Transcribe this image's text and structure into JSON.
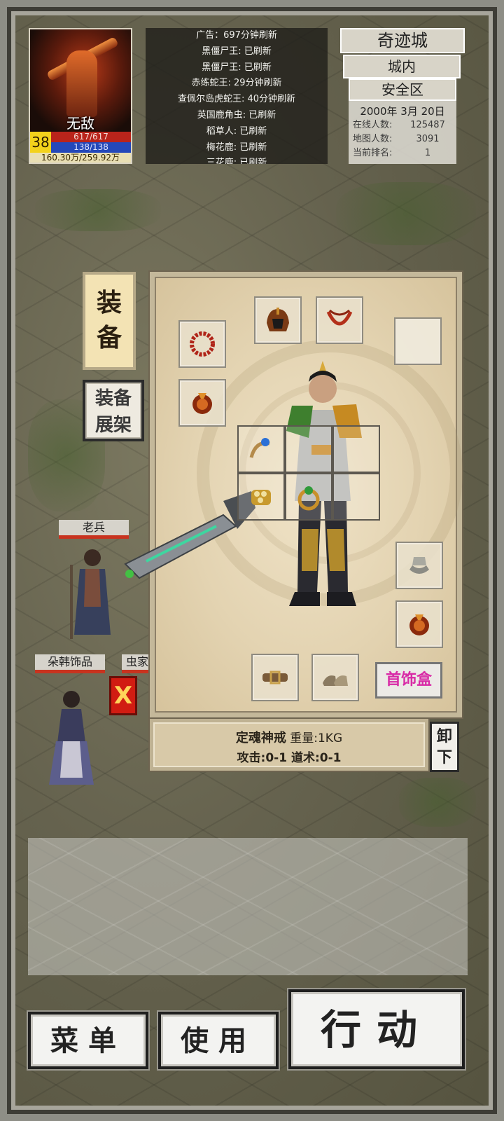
{
  "player": {
    "name": "无敌",
    "level": "38",
    "hp": "617/617",
    "mp": "138/138",
    "exp": "160.30万/259.92万"
  },
  "notices": [
    "广告：697分钟刷新",
    "黑僵尸王: 已刷新",
    "黑僵尸王: 已刷新",
    "赤练蛇王: 29分钟刷新",
    "查佩尔岛虎蛇王: 40分钟刷新",
    "英国鹿角虫: 已刷新",
    "稻草人: 已刷新",
    "梅花鹿: 已刷新",
    "三花鹿: 已刷新"
  ],
  "location": {
    "city": "奇迹城",
    "area": "城内",
    "zone": "安全区",
    "date": "2000年 3月 20日",
    "online_label": "在线人数:",
    "online_value": "125487",
    "map_label": "地图人数:",
    "map_value": "3091",
    "rank_label": "当前排名:",
    "rank_value": "1"
  },
  "tabs": {
    "equip_line1": "装",
    "equip_line2": "备",
    "shelf_line1": "装备",
    "shelf_line2": "展架"
  },
  "npcs": {
    "veteran": "老兵",
    "jewelry": "朵韩饰品",
    "cut": "虫家"
  },
  "close_label": "X",
  "equipment": {
    "jewelry_box": "首饰盒",
    "slots": [
      "helmet-icon",
      "necklace-icon",
      "empty",
      "bracelet-icon",
      "ring-icon",
      "bracelet-icon",
      "ring-icon",
      "ring-icon",
      "ring-icon",
      "empty",
      "empty",
      "bracelet-icon",
      "ring-icon",
      "belt-icon",
      "boots-icon"
    ]
  },
  "item": {
    "name": "定魂神戒",
    "weight": "重量:1KG",
    "stats": "攻击:0-1 道术:0-1"
  },
  "unequip": {
    "line1": "卸",
    "line2": "下"
  },
  "buttons": {
    "menu": "菜单",
    "use": "使用",
    "action": "行动"
  },
  "colors": {
    "hp_bar": "#b9241b",
    "mp_bar": "#2448b9",
    "level_bg": "#f3d21c",
    "jewelry_text": "#d82aa6",
    "npc_underline": "#c8331f"
  }
}
